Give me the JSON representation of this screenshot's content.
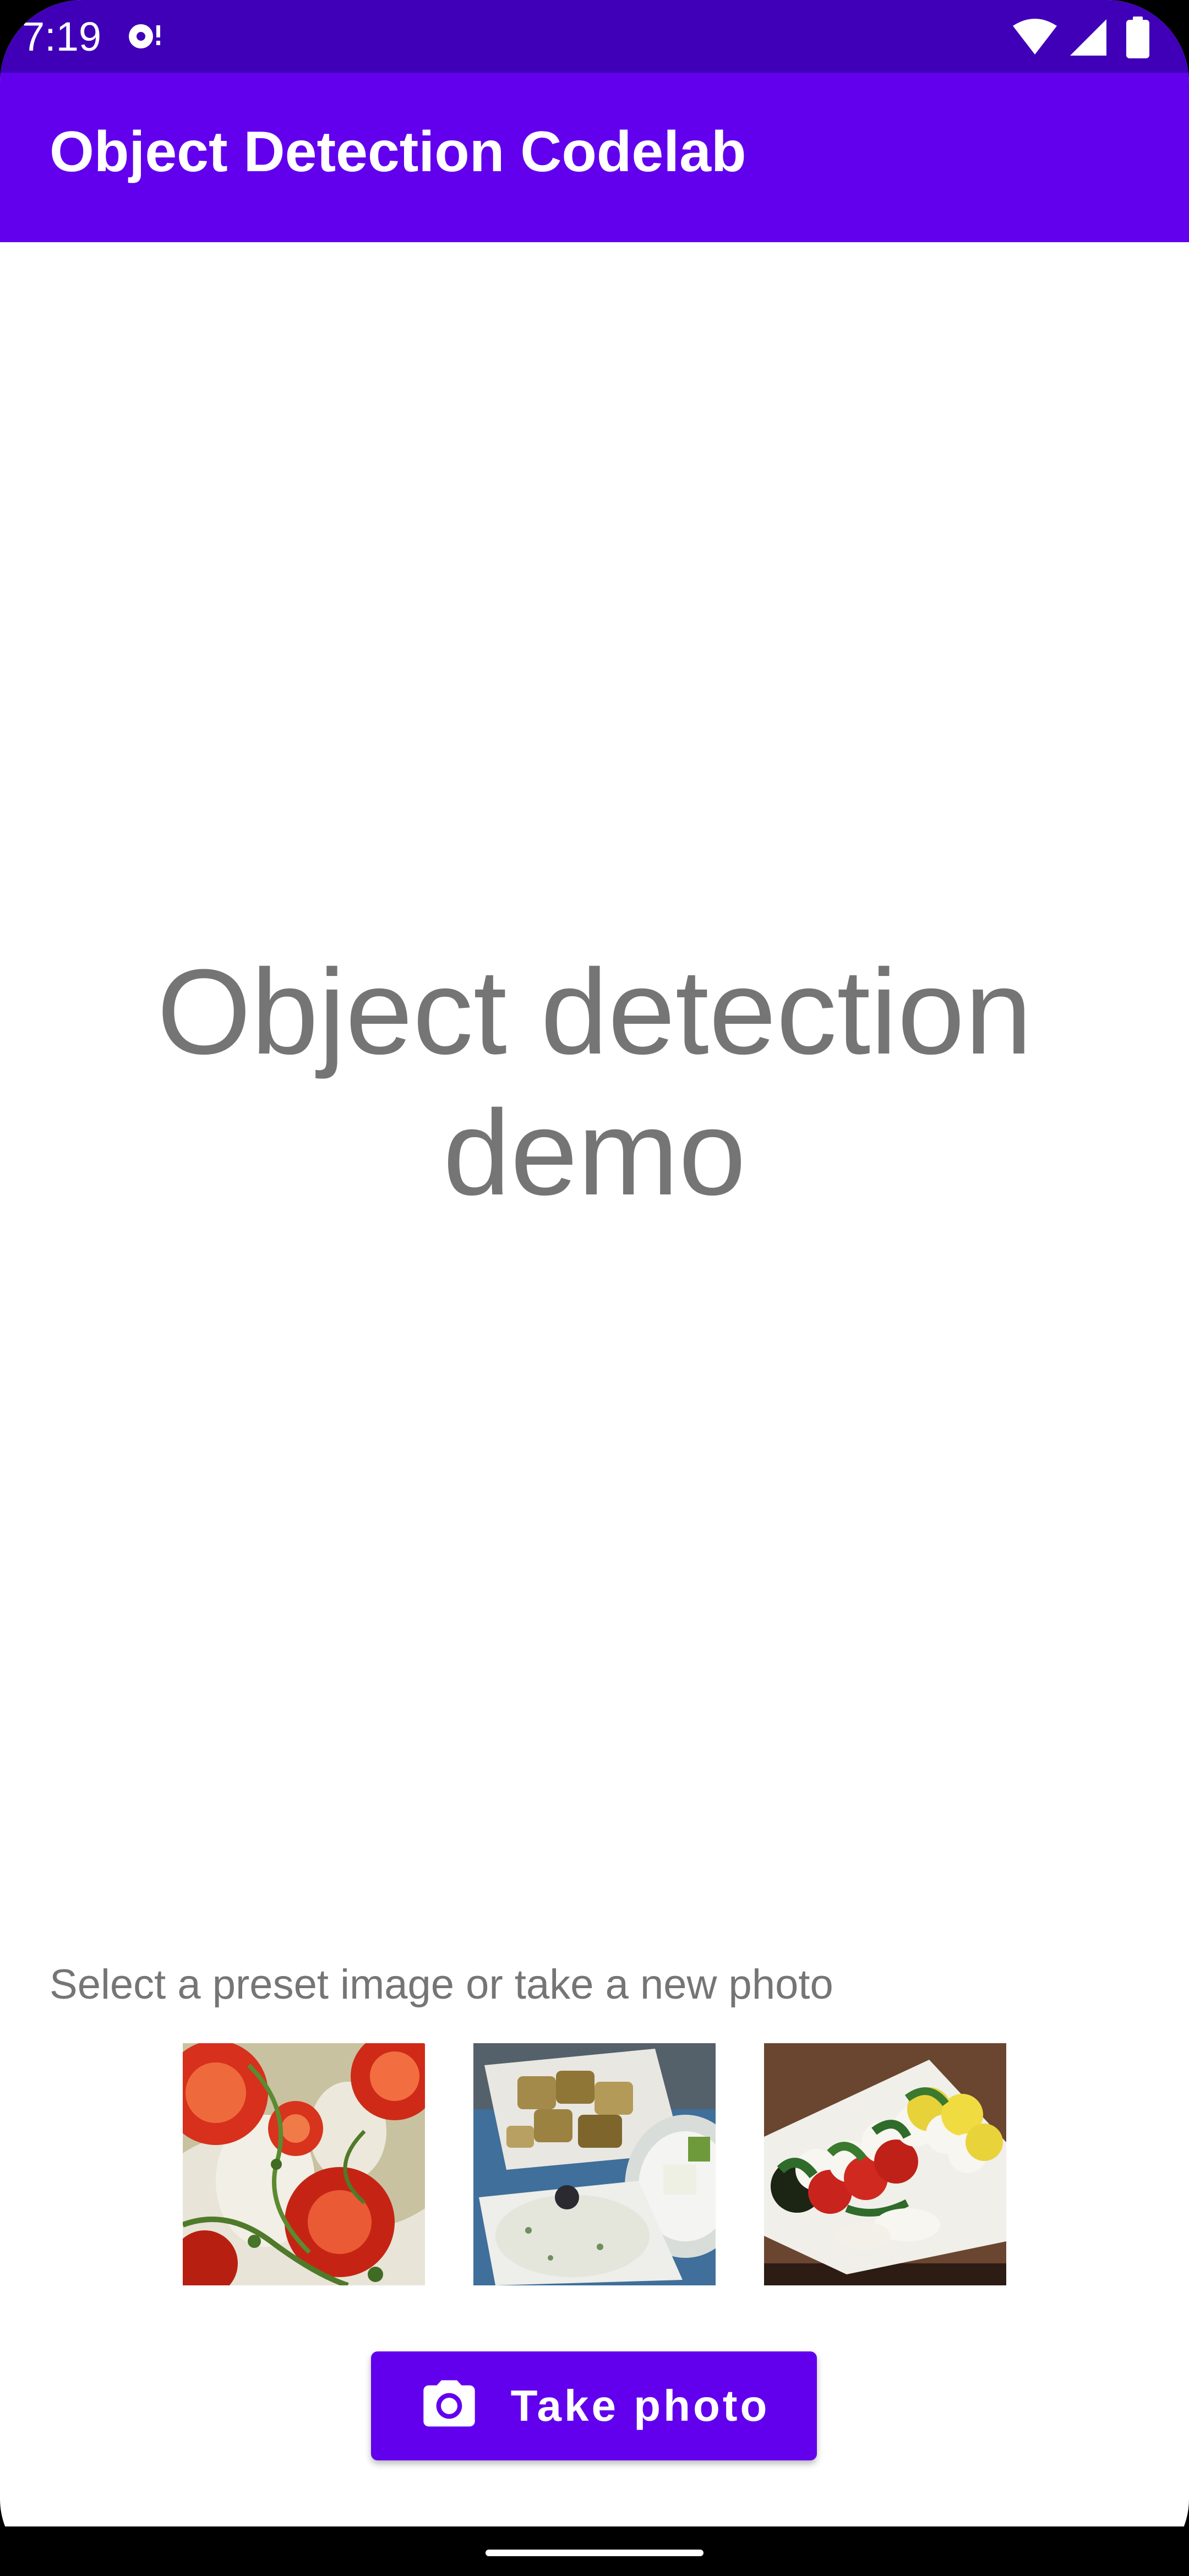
{
  "status_bar": {
    "time": "7:19",
    "icons": [
      "notification-icon",
      "wifi-icon",
      "cell-signal-icon",
      "battery-icon"
    ]
  },
  "app_bar": {
    "title": "Object Detection Codelab"
  },
  "main": {
    "heading": "Object detection demo",
    "prompt": "Select a preset image or take a new photo",
    "preset_images": [
      {
        "subject": "tomatoes with herbs"
      },
      {
        "subject": "roasted potatoes and tzatziki"
      },
      {
        "subject": "caprese salad plate"
      }
    ],
    "take_photo_label": "Take photo"
  },
  "colors": {
    "status_bar": "#3f00b8",
    "app_bar": "#6200ee",
    "button": "#6200ee",
    "secondary_text": "#757575"
  }
}
